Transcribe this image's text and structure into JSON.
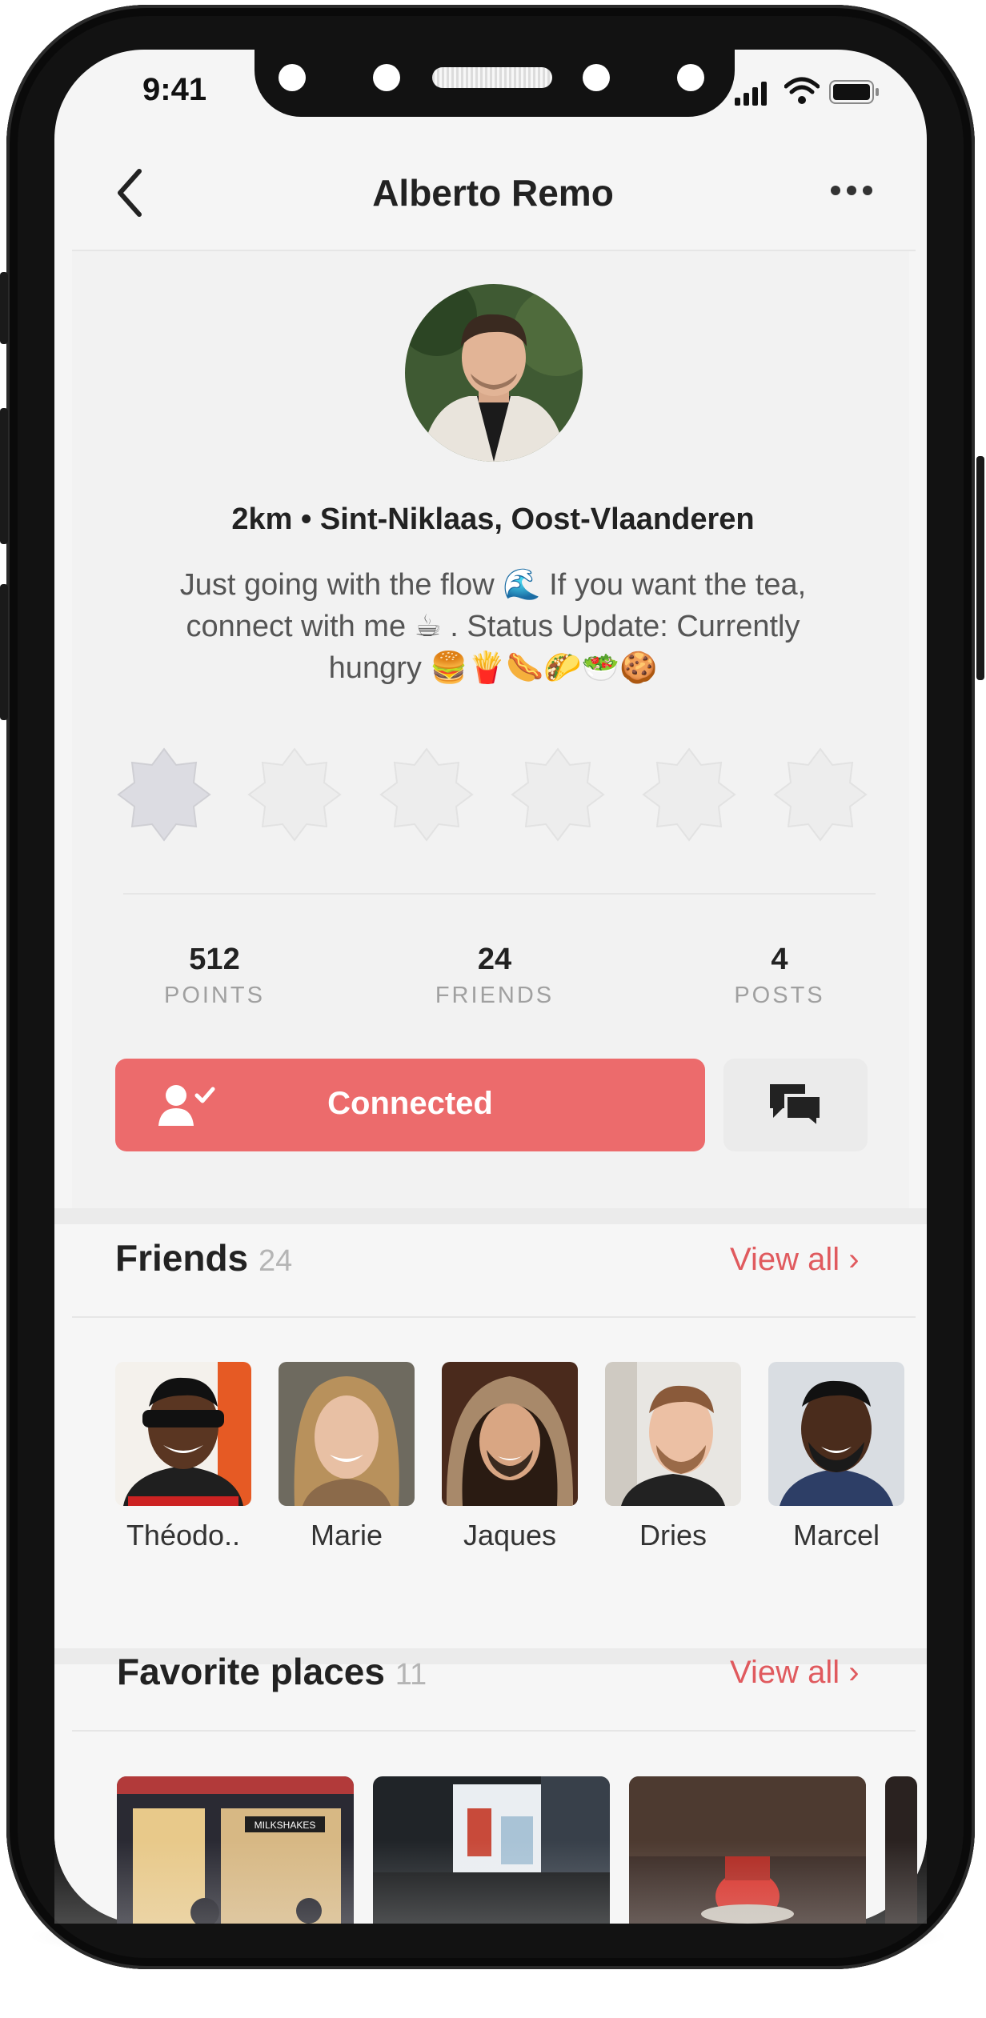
{
  "status_bar": {
    "time": "9:41"
  },
  "header": {
    "title": "Alberto Remo"
  },
  "profile": {
    "location": "2km • Sint-Niklaas, Oost-Vlaanderen",
    "bio_line1": "Just going with the flow 🌊 If you want the tea,",
    "bio_line2": "connect with me ☕ . Status Update: Currently",
    "bio_line3": "hungry 🍔🍟🌭🌮🥗🍪"
  },
  "stats": [
    {
      "value": "512",
      "label": "POINTS"
    },
    {
      "value": "24",
      "label": "FRIENDS"
    },
    {
      "value": "4",
      "label": "POSTS"
    }
  ],
  "actions": {
    "connect_label": "Connected"
  },
  "friends_section": {
    "title": "Friends",
    "count": "24",
    "view_all": "View all ›",
    "items": [
      {
        "name": "Théodo.."
      },
      {
        "name": "Marie"
      },
      {
        "name": "Jaques"
      },
      {
        "name": "Dries"
      },
      {
        "name": "Marcel"
      }
    ]
  },
  "places_section": {
    "title": "Favorite places",
    "count": "11",
    "view_all": "View all ›",
    "place1_sign": "MILKSHAKES"
  },
  "colors": {
    "accent": "#ec6b6c",
    "link": "#e05a5e"
  }
}
